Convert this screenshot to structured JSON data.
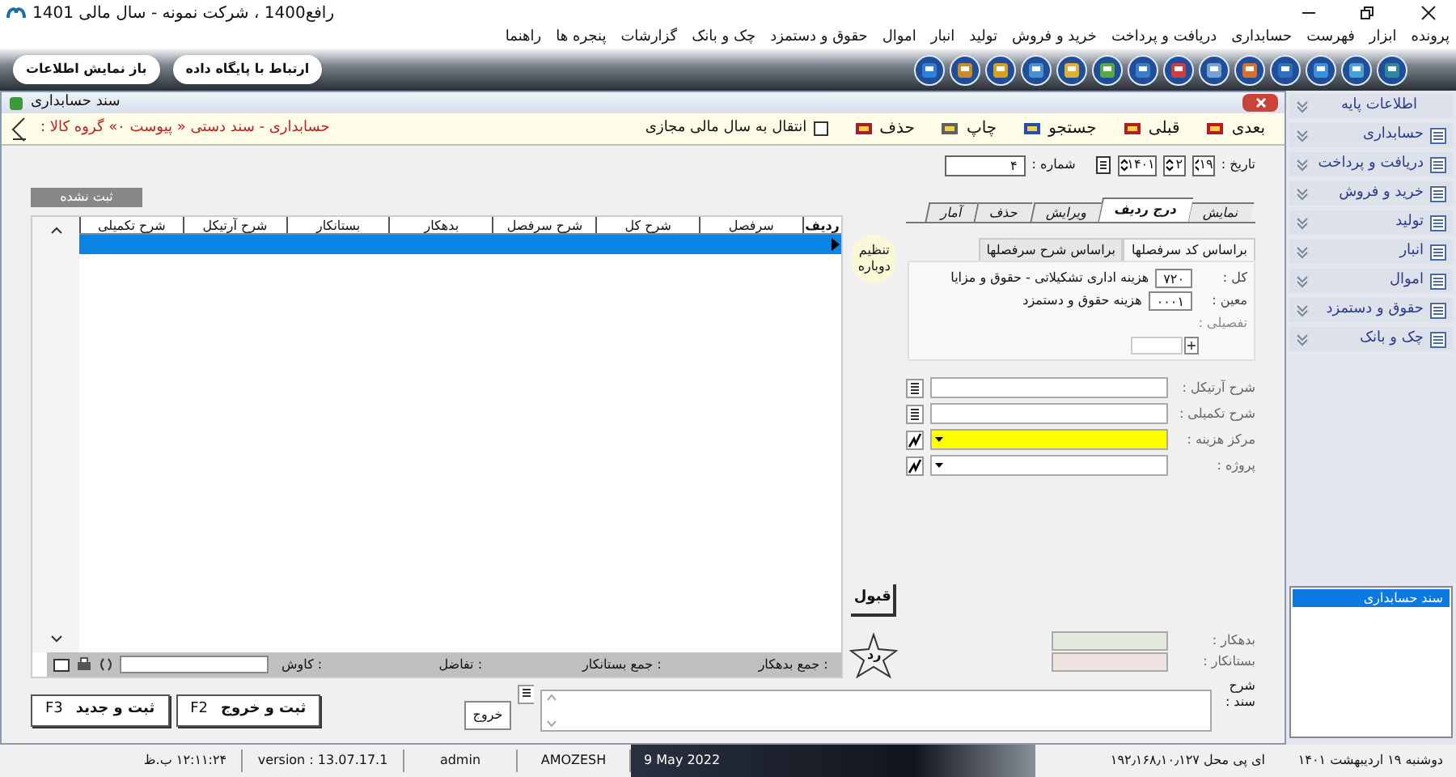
{
  "window": {
    "title": "رافع1400 ، شرکت نمونه - سال مالی 1401"
  },
  "menu": [
    "پرونده",
    "ابزار",
    "فهرست",
    "حسابداری",
    "دریافت و پرداخت",
    "خرید و فروش",
    "تولید",
    "انبار",
    "اموال",
    "حقوق و دستمزد",
    "چک و بانک",
    "گزارشات",
    "پنجره ها",
    "راهنما"
  ],
  "toolbar": {
    "buttons": [
      "ارتباط با پایگاه داده",
      "باز نمایش اطلاعات"
    ]
  },
  "document": {
    "title": "سند حسابداری",
    "actions": [
      "بعدی",
      "قبلی",
      "جستجو",
      "چاپ",
      "حذف"
    ],
    "transfer_checkbox": {
      "label": "انتقال به سال مالی مجازی",
      "checked": false
    },
    "breadcrumb": "حسابداری - سند دستی « پیوست ۰» گروه کالا :",
    "date": {
      "label": "تاریخ :",
      "day": "۱۹",
      "month": "۲",
      "year": "۱۴۰۱"
    },
    "number": {
      "label": "شماره :",
      "value": "۴"
    },
    "tabs": [
      {
        "label": "نمایش",
        "selected": false
      },
      {
        "label": "درج ردیف",
        "selected": true
      },
      {
        "label": "ویرایش",
        "selected": false
      },
      {
        "label": "حذف",
        "selected": false
      },
      {
        "label": "آمار",
        "selected": false
      }
    ],
    "status_badge": "ثبت نشده",
    "table": {
      "columns": [
        "ردیف",
        "سرفصل",
        "شرح کل",
        "شرح سرفصل",
        "بدهکار",
        "بستانکار",
        "شرح آرتیکل",
        "شرح تکمیلی"
      ],
      "rows": [
        {
          "selected": true
        }
      ]
    },
    "footer": {
      "debit_sum": "جمع بدهکار :",
      "credit_sum": "جمع بستانکار :",
      "difference": "تفاضل :",
      "search_label": "کاوش :"
    },
    "reset_button": "تنظیم دوباره",
    "lookup_tabs": [
      {
        "label": "براساس کد سرفصلها",
        "selected": true
      },
      {
        "label": "براساس شرح سرفصلها",
        "selected": false
      }
    ],
    "accounts": [
      {
        "label": "کل :",
        "code": "۷۲۰",
        "name": "هزینه اداری تشکیلاتی - حقوق و مزایا",
        "disabled": false
      },
      {
        "label": "معین :",
        "code": "۰۰۰۱",
        "name": "هزینه حقوق و دستمزد",
        "disabled": false
      },
      {
        "label": "تفصیلی :",
        "disabled": true,
        "add_button": "+"
      }
    ],
    "fields": [
      {
        "label": "شرح آرتیکل :",
        "kind": "text",
        "highlighted": false
      },
      {
        "label": "شرح تکمیلی :",
        "kind": "text",
        "highlighted": false
      },
      {
        "label": "مرکز هزینه :",
        "kind": "dropdown",
        "highlighted": true
      },
      {
        "label": "پروژه :",
        "kind": "dropdown",
        "highlighted": false
      }
    ],
    "accept_button": "قبول",
    "reject_button": "رد",
    "totals": [
      {
        "label": "بدهکار :",
        "color": "#e3ecdc"
      },
      {
        "label": "بستانکار :",
        "color": "#f0e4e0"
      }
    ],
    "description_label": "شرح سند :",
    "exit_button": "خروج",
    "save_buttons": [
      {
        "label": "ثبت و خروج",
        "key": "F2"
      },
      {
        "label": "ثبت و جدید",
        "key": "F3"
      }
    ]
  },
  "sidebar": {
    "items": [
      "اطلاعات پایه",
      "حسابداری",
      "دریافت و پرداخت",
      "خرید و فروش",
      "تولید",
      "انبار",
      "اموال",
      "حقوق و دستمزد",
      "چک و بانک"
    ],
    "open_windows": [
      {
        "label": "سند حسابداری",
        "selected": true
      }
    ]
  },
  "status_bar": [
    "دوشنبه ۱۹ اردیبهشت ۱۴۰۱",
    "ای پی محل ۱۹۲٫۱۶۸٫۱۰٫۱۲۷",
    "9 May 2022",
    "AMOZESH",
    "admin",
    "version : 13.07.17.1",
    "۱۲:۱۱:۲۴ ب.ظ"
  ]
}
